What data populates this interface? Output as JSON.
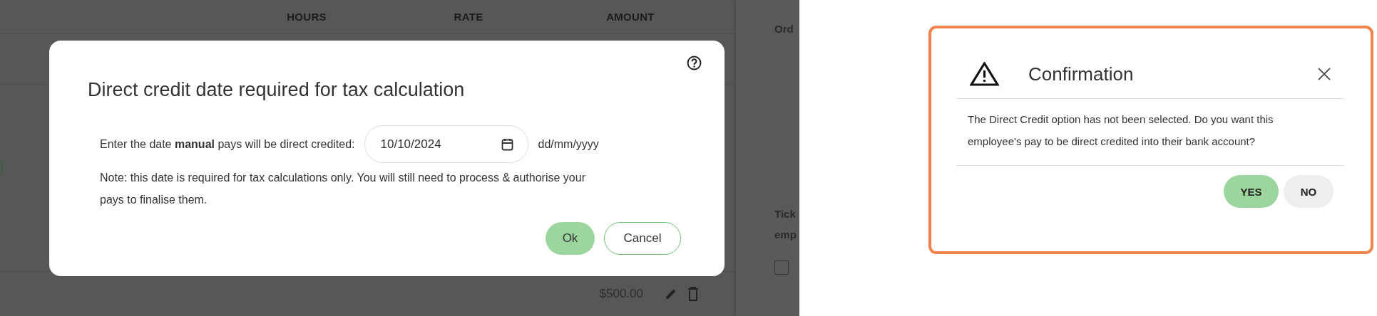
{
  "background_page": {
    "columns": [
      "HOURS",
      "RATE",
      "AMOUNT"
    ],
    "row": {
      "amount": "$500.00"
    },
    "side_panel": {
      "texts": [
        "Ord",
        "Tick",
        "emp"
      ],
      "checkbox": {
        "checked": false
      }
    }
  },
  "direct_credit_dialog": {
    "title": "Direct credit date required for tax calculation",
    "date_label": "Enter the date **manual** pays will be direct credited:",
    "date_value": "10/10/2024",
    "date_format": "dd/mm/yyyy",
    "note": "Note: this date is required for tax calculations only. You will still need to process & authorise your pays to finalise them.",
    "buttons": [
      {
        "label": "Ok",
        "kind": "primary"
      },
      {
        "label": "Cancel",
        "kind": "secondary"
      }
    ]
  },
  "confirmation_dialog": {
    "title": "Confirmation",
    "message": "The Direct Credit option has not been selected. Do you want this employee's pay to be direct credited into their bank account?",
    "buttons": [
      {
        "label": "YES",
        "kind": "primary"
      },
      {
        "label": "NO",
        "kind": "secondary"
      }
    ]
  }
}
